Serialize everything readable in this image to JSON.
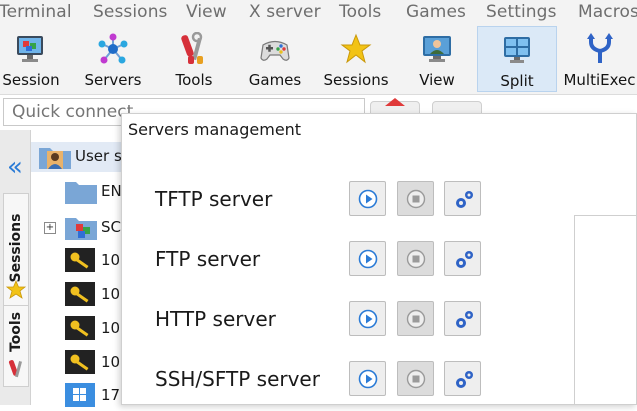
{
  "menu": [
    "Terminal",
    "Sessions",
    "View",
    "X server",
    "Tools",
    "Games",
    "Settings",
    "Macros"
  ],
  "toolbar": {
    "buttons": [
      {
        "label": "Session",
        "icon": "session-icon"
      },
      {
        "label": "Servers",
        "icon": "servers-icon"
      },
      {
        "label": "Tools",
        "icon": "tools-icon"
      },
      {
        "label": "Games",
        "icon": "gamepad-icon"
      },
      {
        "label": "Sessions",
        "icon": "star-icon"
      },
      {
        "label": "View",
        "icon": "view-icon"
      },
      {
        "label": "Split",
        "icon": "split-icon",
        "active": true
      },
      {
        "label": "MultiExec",
        "icon": "multiexec-icon"
      }
    ]
  },
  "quick_connect": {
    "placeholder": "Quick connect..."
  },
  "left_tabs": {
    "sessions": "Sessions",
    "tools": "Tools",
    "collapse_icon": "double-chevron-left-icon"
  },
  "tree": {
    "items": [
      {
        "label": "User se",
        "icon": "user-folder-icon"
      },
      {
        "label": "EN",
        "icon": "folder-icon"
      },
      {
        "label": "SC",
        "icon": "folder-group-icon"
      },
      {
        "label": "10",
        "icon": "key-icon"
      },
      {
        "label": "10",
        "icon": "key-icon"
      },
      {
        "label": "10",
        "icon": "key-icon"
      },
      {
        "label": "10",
        "icon": "key-icon"
      },
      {
        "label": "17",
        "icon": "windows-icon"
      }
    ]
  },
  "dialog": {
    "title": "Servers management",
    "servers": [
      {
        "name": "TFTP server"
      },
      {
        "name": "FTP server"
      },
      {
        "name": "HTTP server"
      },
      {
        "name": "SSH/SFTP server"
      }
    ]
  },
  "colors": {
    "accent": "#2b7bd6",
    "toolbar_bg": "#f3f3f3",
    "active_button": "#dbe9f7"
  }
}
